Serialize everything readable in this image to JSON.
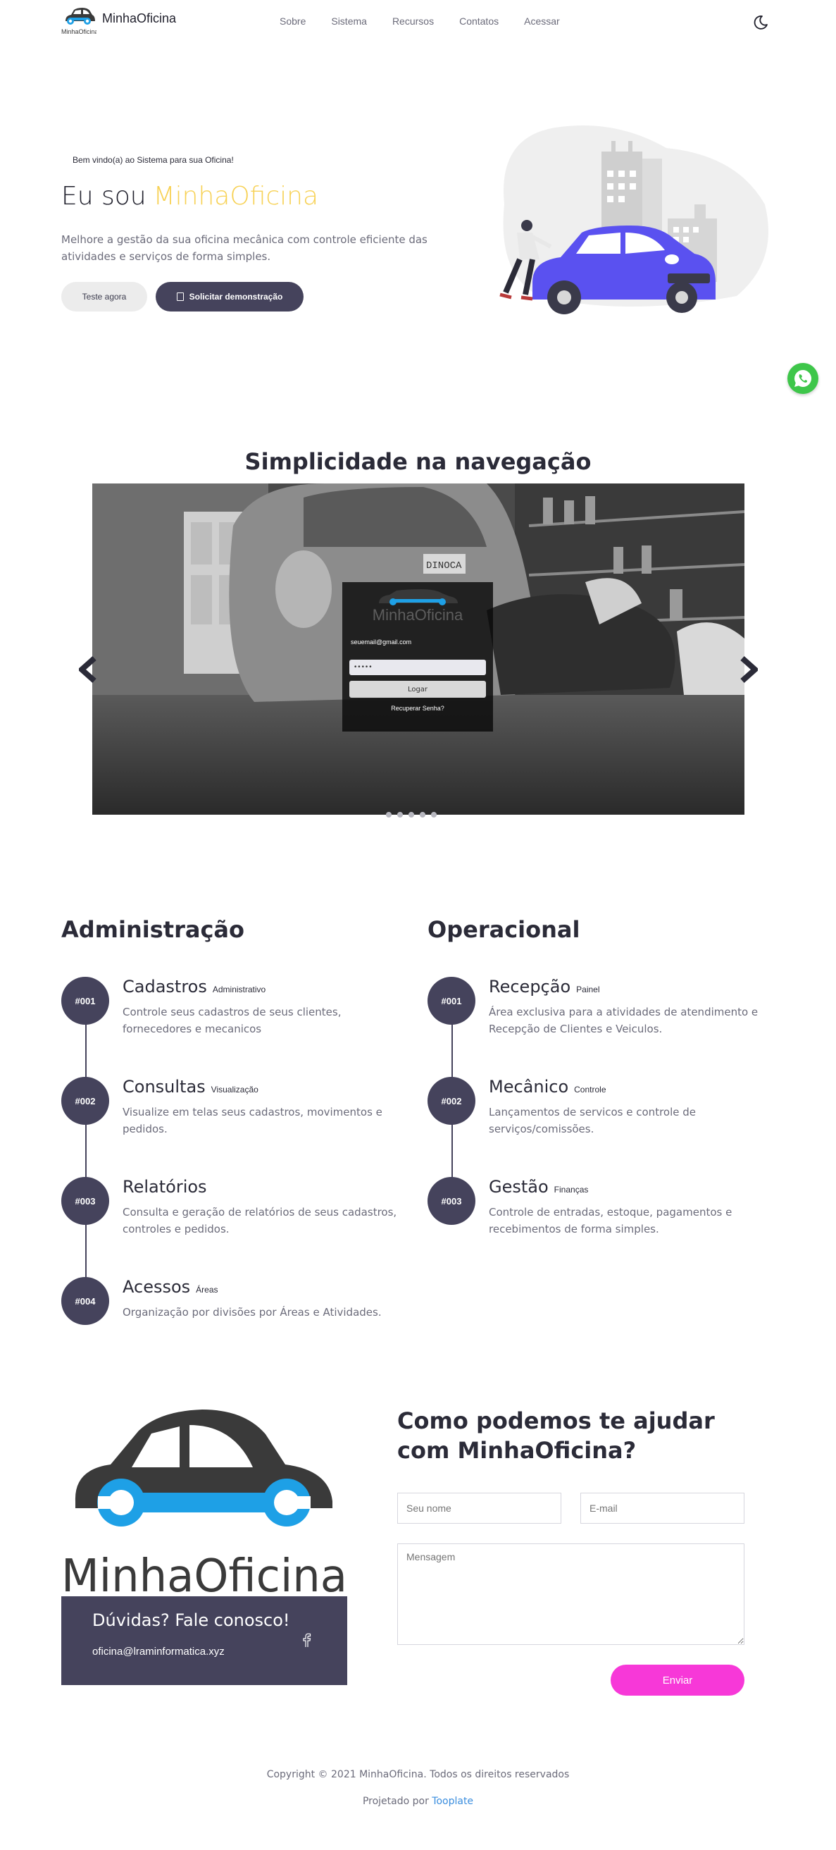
{
  "nav": {
    "brand": "MinhaOficina",
    "brand_small": "MinhaOficina",
    "links": [
      "Sobre",
      "Sistema",
      "Recursos",
      "Contatos",
      "Acessar"
    ]
  },
  "hero": {
    "welcome": "Bem vindo(a) ao Sistema para sua Oficina!",
    "title_prefix": "Eu sou",
    "title_accent": "MinhaOficina",
    "description": "Melhore a gestão da sua oficina mecânica com controle eficiente das atividades e serviços de forma simples.",
    "btn_try": "Teste agora",
    "btn_demo": "Solicitar demonstração"
  },
  "carousel": {
    "title": "Simplicidade na navegação",
    "login_logo": "MinhaOficina",
    "login_email": "seuemail@gmail.com",
    "login_password": "•••••",
    "login_button": "Logar",
    "login_recover": "Recuperar Senha?",
    "plate": "DINOCA",
    "slides": 5
  },
  "admin": {
    "title": "Administração",
    "items": [
      {
        "num": "#001",
        "title": "Cadastros",
        "tag": "Administrativo",
        "desc": "Controle seus cadastros de seus clientes, fornecedores e mecanicos"
      },
      {
        "num": "#002",
        "title": "Consultas",
        "tag": "Visualização",
        "desc": "Visualize em telas seus cadastros, movimentos e pedidos."
      },
      {
        "num": "#003",
        "title": "Relatórios",
        "tag": "",
        "desc": "Consulta e geração de relatórios de seus cadastros, controles e pedidos."
      },
      {
        "num": "#004",
        "title": "Acessos",
        "tag": "Áreas",
        "desc": "Organização por divisões por Áreas e Atividades."
      }
    ]
  },
  "oper": {
    "title": "Operacional",
    "items": [
      {
        "num": "#001",
        "title": "Recepção",
        "tag": "Painel",
        "desc": "Área exclusiva para a atividades de atendimento e Recepção de Clientes e Veiculos."
      },
      {
        "num": "#002",
        "title": "Mecânico",
        "tag": "Controle",
        "desc": "Lançamentos de servicos e controle de serviços/comissões."
      },
      {
        "num": "#003",
        "title": "Gestão",
        "tag": "Finanças",
        "desc": "Controle de entradas, estoque, pagamentos e recebimentos de forma simples."
      }
    ]
  },
  "contact": {
    "logo_text": "MinhaOficina",
    "question": "Dúvidas? Fale conosco!",
    "email": "oficina@lraminformatica.xyz",
    "form_title": "Como podemos te ajudar com MinhaOficina?",
    "name_placeholder": "Seu nome",
    "email_placeholder": "E-mail",
    "message_placeholder": "Mensagem",
    "send": "Enviar"
  },
  "footer": {
    "copyright": "Copyright © 2021 MinhaOficina. Todos os direitos reservados",
    "designed_prefix": "Projetado por ",
    "designed_link": "Tooplate"
  },
  "colors": {
    "primary": "#45435c",
    "accent_yellow": "#f7d154",
    "send_pink": "#f738d8",
    "car_blue": "#5a51f0",
    "whatsapp": "#3ec64a"
  }
}
